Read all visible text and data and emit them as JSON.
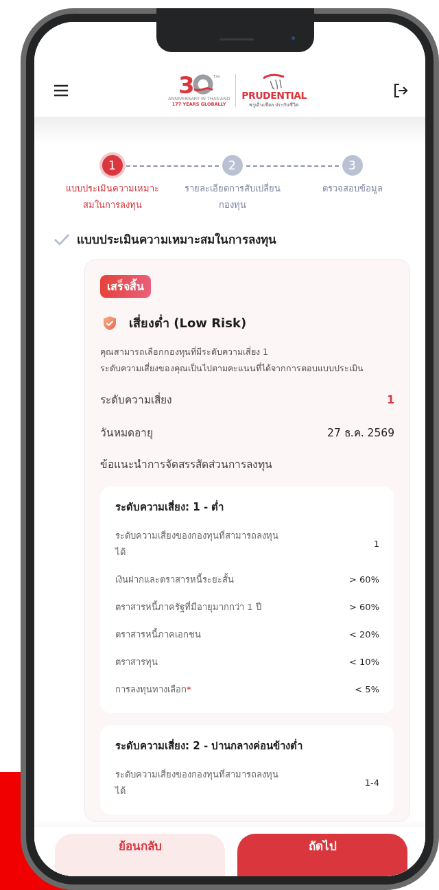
{
  "header": {
    "logo_number": "3",
    "logo_suffix": "TH",
    "logo_anniversary": "ANNIVERSARY IN THAILAND",
    "logo_years": "177 YEARS GLOBALLY",
    "logo_brand": "PRUDENTIAL",
    "logo_brand_thai": "พรูเด็นเชียล ประกันชีวิต"
  },
  "steps": [
    {
      "number": "1",
      "label": "แบบประเมินความเหมาะสมในการลงทุน",
      "selected": true
    },
    {
      "number": "2",
      "label": "รายละเอียดการสับเปลี่ยนกองทุน",
      "selected": false
    },
    {
      "number": "3",
      "label": "ตรวจสอบข้อมูล",
      "selected": false
    }
  ],
  "section": {
    "title": "แบบประเมินความเหมาะสมในการลงทุน",
    "completed": true
  },
  "result": {
    "badge": "เสร็จสิ้น",
    "risk_title": "เสี่ยงต่ำ (Low Risk)",
    "description": [
      "คุณสามารถเลือกกองทุนที่มีระดับความเสี่ยง 1",
      "ระดับความเสี่ยงของคุณเป็นไปตามคะแนนที่ได้จากการตอบแบบประเมิน"
    ],
    "fields": [
      {
        "label": "ระดับความเสี่ยง",
        "value": "1",
        "kind": "highlight"
      },
      {
        "label": "วันหมดอายุ",
        "value": "27 ธ.ค. 2569",
        "kind": "plain"
      }
    ],
    "advice_title": "ข้อแนะนำการจัดสรรสัดส่วนการลงทุน",
    "allocations": [
      {
        "title": "ระดับความเสี่ยง: 1 - ต่ำ",
        "rows": [
          {
            "label": "ระดับความเสี่ยงของกองทุนที่สามารถลงทุนได้",
            "value": "1"
          },
          {
            "label": "เงินฝากและตราสารหนี้ระยะสั้น",
            "value": "> 60%"
          },
          {
            "label": "ตราสารหนี้ภาครัฐที่มีอายุมากกว่า 1 ปี",
            "value": "> 60%"
          },
          {
            "label": "ตราสารหนี้ภาคเอกชน",
            "value": "< 20%"
          },
          {
            "label": "ตราสารทุน",
            "value": "< 10%"
          },
          {
            "label": "การลงทุนทางเลือก",
            "value": "< 5%",
            "footnote_mark": "*"
          }
        ]
      },
      {
        "title": "ระดับความเสี่ยง: 2 - ปานกลางค่อนข้างต่ำ",
        "rows": [
          {
            "label": "ระดับความเสี่ยงของกองทุนที่สามารถลงทุนได้",
            "value": "1-4"
          }
        ]
      }
    ]
  },
  "buttons": [
    {
      "label": "ย้อนกลับ",
      "kind": "secondary"
    },
    {
      "label": "ถัดไป",
      "kind": "primary"
    }
  ]
}
